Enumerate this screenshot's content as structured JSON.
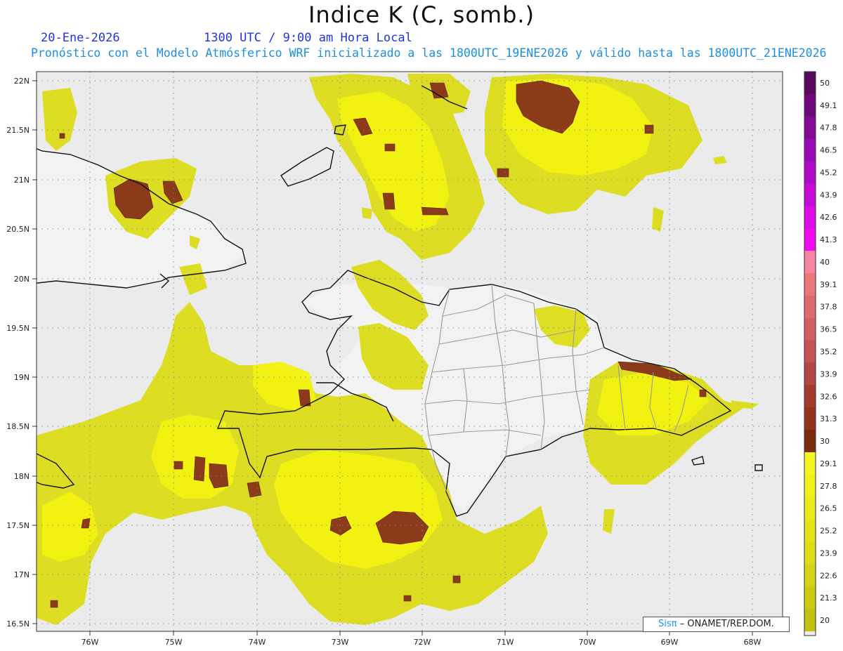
{
  "header": {
    "title": "Indice K (C, somb.)",
    "date": "20-Ene-2026",
    "time": "1300 UTC / 9:00 am Hora Local",
    "description": "Pronóstico con el Modelo Atmósferico WRF inicializado a las 1800UTC_19ENE2026 y válido hasta las  1800UTC_21ENE2026"
  },
  "map": {
    "lat_labels": [
      "22N",
      "21.5N",
      "21N",
      "20.5N",
      "20N",
      "19.5N",
      "19N",
      "18.5N",
      "18N",
      "17.5N",
      "17N",
      "16.5N"
    ],
    "lon_labels": [
      "76W",
      "75W",
      "74W",
      "73W",
      "72W",
      "71W",
      "70W",
      "69W",
      "68W"
    ],
    "colors": {
      "background": "#ebebeb",
      "land_fill": "#f2f2f2",
      "coastline": "#111111",
      "province_border": "#9a9a9a",
      "grid": "#888888",
      "low_k": "#dcdc10",
      "mid_k": "#f2f212",
      "high_k": "#8b3a1a"
    }
  },
  "colorbar": {
    "labels": [
      "50",
      "49.1",
      "47.8",
      "46.5",
      "45.2",
      "43.9",
      "42.6",
      "41.3",
      "40",
      "39.1",
      "37.8",
      "36.5",
      "35.2",
      "33.9",
      "32.6",
      "31.3",
      "30",
      "29.1",
      "27.8",
      "26.5",
      "25.2",
      "23.9",
      "22.6",
      "21.3",
      "20"
    ],
    "colors": [
      "#5a0a5a",
      "#6e0a78",
      "#840a96",
      "#9a0ab4",
      "#b00ac8",
      "#c60ad8",
      "#dc0ae6",
      "#f00af0",
      "#f585a0",
      "#ea7878",
      "#de6c6c",
      "#d26060",
      "#c45454",
      "#b44646",
      "#a43a2c",
      "#92331e",
      "#7a2c10",
      "#f5f525",
      "#efef1e",
      "#e9e91c",
      "#e3e31a",
      "#dcdc18",
      "#d4d416",
      "#cbcb14",
      "#c2c212"
    ]
  },
  "credit": {
    "brand": "Sisπ",
    "text": "– ONAMET/REP.DOM."
  }
}
